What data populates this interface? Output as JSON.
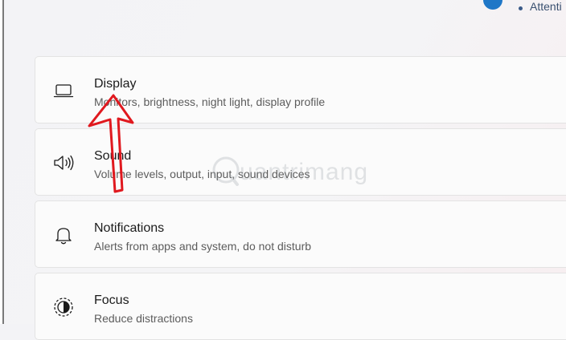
{
  "header": {
    "attention_text": "Attenti"
  },
  "settings": {
    "items": [
      {
        "icon": "laptop-icon",
        "title": "Display",
        "subtitle": "Monitors, brightness, night light, display profile"
      },
      {
        "icon": "speaker-icon",
        "title": "Sound",
        "subtitle": "Volume levels, output, input, sound devices"
      },
      {
        "icon": "bell-icon",
        "title": "Notifications",
        "subtitle": "Alerts from apps and system, do not disturb"
      },
      {
        "icon": "focus-icon",
        "title": "Focus",
        "subtitle": "Reduce distractions"
      }
    ]
  },
  "watermark": {
    "text": "uantrimang"
  },
  "colors": {
    "annotation_arrow": "#e0191f",
    "accent": "#1f77c7"
  }
}
